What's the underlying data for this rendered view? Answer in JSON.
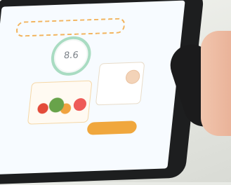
{
  "photo": {
    "score_value": "8.6"
  },
  "colors": {
    "screen_background": "#f7fbff",
    "tablet_bezel": "#1d1e1f",
    "accent_orange": "#f0a73d",
    "score_ring_green": "#a9dcc2"
  }
}
